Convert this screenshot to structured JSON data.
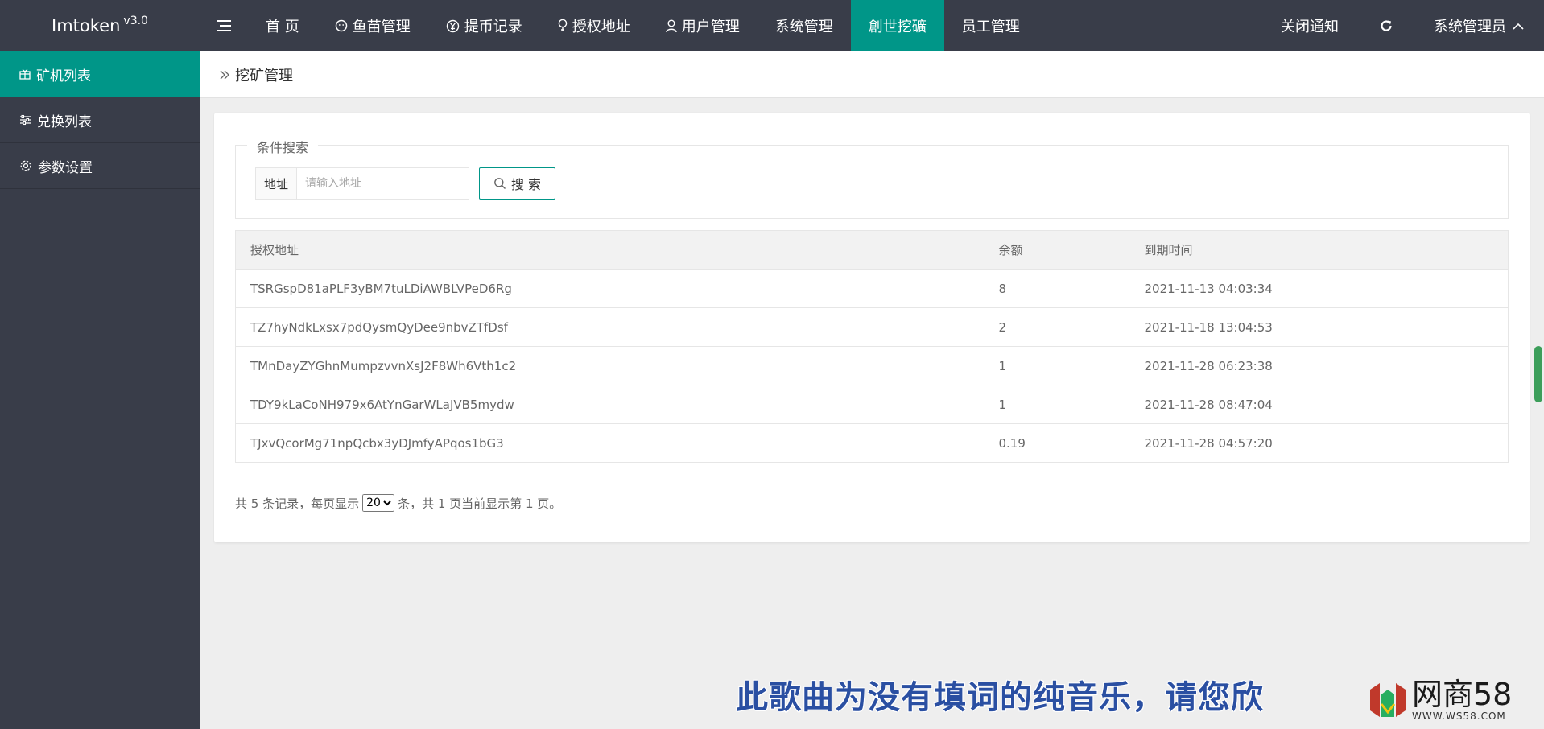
{
  "app": {
    "name": "Imtoken",
    "version": "v3.0"
  },
  "nav": [
    {
      "label": "首 页",
      "icon": ""
    },
    {
      "label": "鱼苗管理",
      "icon": "smile-icon"
    },
    {
      "label": "提币记录",
      "icon": "yen-icon"
    },
    {
      "label": "授权地址",
      "icon": "bulb-icon"
    },
    {
      "label": "用户管理",
      "icon": "user-icon"
    },
    {
      "label": "系统管理",
      "icon": ""
    },
    {
      "label": "創世挖礦",
      "icon": "",
      "active": true
    },
    {
      "label": "员工管理",
      "icon": ""
    }
  ],
  "top_right": {
    "notify": "关闭通知",
    "user": "系统管理员"
  },
  "sidebar": {
    "items": [
      {
        "label": "矿机列表",
        "icon": "gift-icon",
        "active": true
      },
      {
        "label": "兑换列表",
        "icon": "sliders-icon"
      },
      {
        "label": "参数设置",
        "icon": "gear-icon"
      }
    ]
  },
  "breadcrumb": "挖矿管理",
  "search": {
    "legend": "条件搜索",
    "label": "地址",
    "placeholder": "请输入地址",
    "button": "搜 索"
  },
  "table": {
    "headers": [
      "授权地址",
      "余额",
      "到期时间"
    ],
    "rows": [
      [
        "TSRGspD81aPLF3yBM7tuLDiAWBLVPeD6Rg",
        "8",
        "2021-11-13 04:03:34"
      ],
      [
        "TZ7hyNdkLxsx7pdQysmQyDee9nbvZTfDsf",
        "2",
        "2021-11-18 13:04:53"
      ],
      [
        "TMnDayZYGhnMumpzvvnXsJ2F8Wh6Vth1c2",
        "1",
        "2021-11-28 06:23:38"
      ],
      [
        "TDY9kLaCoNH979x6AtYnGarWLaJVB5mydw",
        "1",
        "2021-11-28 08:47:04"
      ],
      [
        "TJxvQcorMg71npQcbx3yDJmfyAPqos1bG3",
        "0.19",
        "2021-11-28 04:57:20"
      ]
    ]
  },
  "pager": {
    "prefix": "共 5 条记录，每页显示",
    "page_size": "20",
    "suffix": "条，共 1 页当前显示第 1 页。"
  },
  "overlay": {
    "subtitle": "此歌曲为没有填词的纯音乐，请您欣",
    "watermark_main": "网商58",
    "watermark_sub": "WWW.WS58.COM"
  },
  "colors": {
    "accent": "#009688",
    "header_bg": "#393d49"
  }
}
